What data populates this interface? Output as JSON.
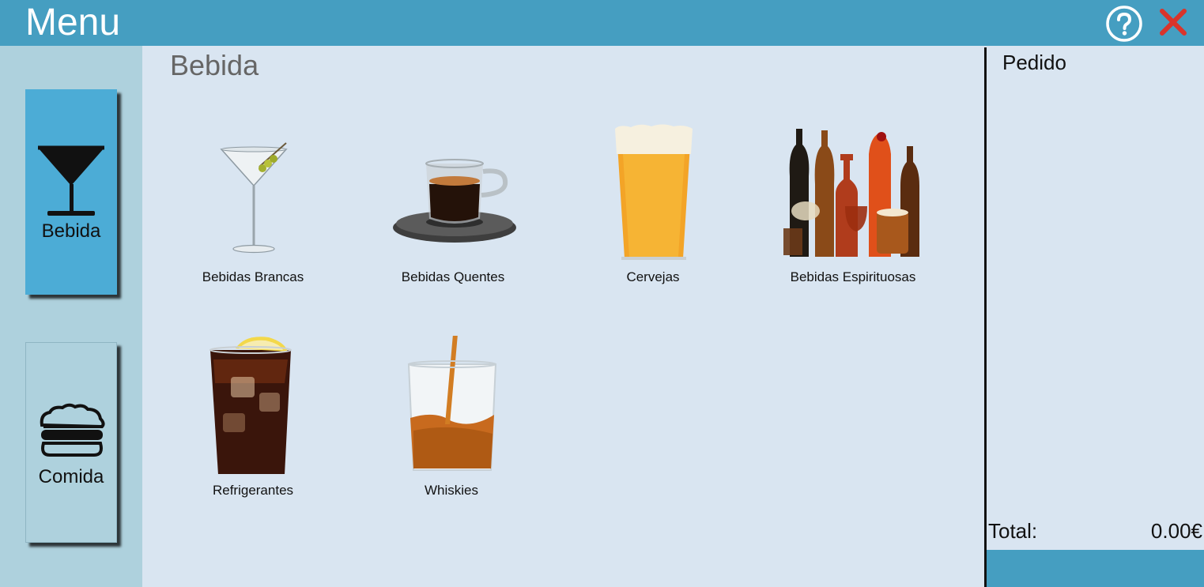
{
  "header": {
    "title": "Menu",
    "help_icon": "question-circle-icon",
    "close_icon": "close-x-icon",
    "color": "#459ec1",
    "close_color": "#d9342b"
  },
  "sidebar": {
    "categories": [
      {
        "label": "Bebida",
        "icon": "cocktail-glass-icon",
        "selected": true,
        "color": "#4cacd6"
      },
      {
        "label": "Comida",
        "icon": "burger-icon",
        "selected": false,
        "color": "#aed1dd"
      }
    ]
  },
  "main": {
    "section_title": "Bebida",
    "items": [
      {
        "label": "Bebidas Brancas",
        "image": "martini-glass"
      },
      {
        "label": "Bebidas Quentes",
        "image": "espresso-cup"
      },
      {
        "label": "Cervejas",
        "image": "beer-pint"
      },
      {
        "label": "Bebidas Espirituosas",
        "image": "liquor-bottles"
      },
      {
        "label": "Refrigerantes",
        "image": "cola-glass"
      },
      {
        "label": "Whiskies",
        "image": "whisky-glass"
      }
    ]
  },
  "order": {
    "title": "Pedido",
    "total_label": "Total:",
    "total_value": "0.00€"
  }
}
